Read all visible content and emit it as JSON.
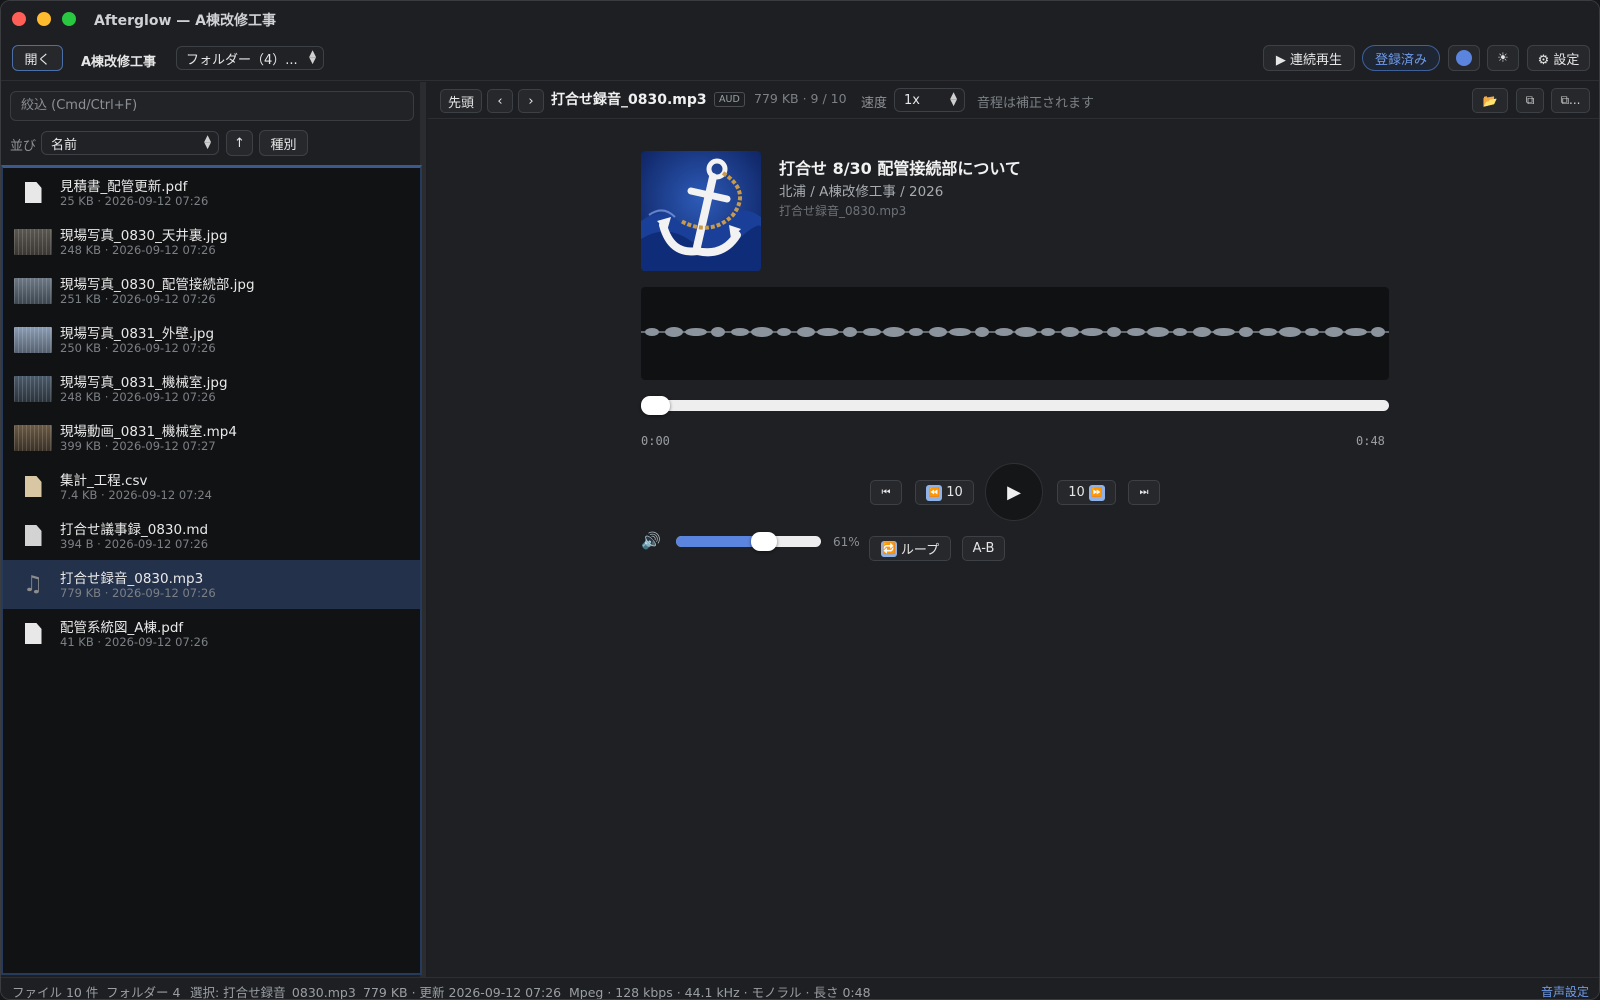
{
  "window": {
    "title": "Afterglow — A棟改修工事"
  },
  "toolbar": {
    "open_label": "開く",
    "project_label": "A棟改修工事",
    "folder_select": "フォルダー（4）...",
    "continuous_label": "▶ 連続再生",
    "registered_label": "登録済み",
    "theme_icon": "☀",
    "settings_label": "⚙ 設定",
    "accent_color": "#5b84de"
  },
  "sidebar": {
    "filter_placeholder": "絞込 (Cmd/Ctrl+F)",
    "sort_label": "並び",
    "sort_value": "名前",
    "sort_dir_icon": "↑",
    "kind_label": "種別",
    "files": [
      {
        "name": "見積書_配管更新.pdf",
        "meta": "25 KB · 2026-09-12 07:26",
        "icon": "pdf-icon"
      },
      {
        "name": "現場写真_0830_天井裏.jpg",
        "meta": "248 KB · 2026-09-12 07:26",
        "icon": "photo-thumbnail"
      },
      {
        "name": "現場写真_0830_配管接続部.jpg",
        "meta": "251 KB · 2026-09-12 07:26",
        "icon": "photo-thumbnail"
      },
      {
        "name": "現場写真_0831_外壁.jpg",
        "meta": "250 KB · 2026-09-12 07:26",
        "icon": "photo-thumbnail"
      },
      {
        "name": "現場写真_0831_機械室.jpg",
        "meta": "248 KB · 2026-09-12 07:26",
        "icon": "photo-thumbnail"
      },
      {
        "name": "現場動画_0831_機械室.mp4",
        "meta": "399 KB · 2026-09-12 07:27",
        "icon": "video-thumbnail"
      },
      {
        "name": "集計_工程.csv",
        "meta": "7.4 KB · 2026-09-12 07:24",
        "icon": "csv-icon"
      },
      {
        "name": "打合せ議事録_0830.md",
        "meta": "394 B · 2026-09-12 07:26",
        "icon": "markdown-icon"
      },
      {
        "name": "打合せ録音_0830.mp3",
        "meta": "779 KB · 2026-09-12 07:26",
        "icon": "music-note-icon",
        "selected": true
      },
      {
        "name": "配管系統図_A棟.pdf",
        "meta": "41 KB · 2026-09-12 07:26",
        "icon": "pdf-icon"
      }
    ]
  },
  "preview": {
    "first_label": "先頭",
    "prev_icon": "‹",
    "next_icon": "›",
    "filename": "打合せ録音_0830.mp3",
    "badge": "AUD",
    "meta": "779 KB · 9 / 10",
    "speed_label": "速度",
    "speed_value": "1x",
    "pitch_note": "音程は補正されます",
    "folder_icon": "📂",
    "copy_icon": "⧉",
    "copy_more_label": "⧉..."
  },
  "player": {
    "title": "打合せ 8/30 配管接続部について",
    "artist": "北浦 / A棟改修工事 / 2026",
    "file": "打合せ録音_0830.mp3",
    "time_start": "0:00",
    "time_end": "0:48",
    "progress": 0.0,
    "skip_start_icon": "⏮",
    "back_label": "10",
    "back_icon": "⏪",
    "play_icon": "▶",
    "forward_label": "10",
    "forward_icon": "⏩",
    "skip_end_icon": "⏭",
    "volume_icon": "🔊",
    "volume_percent": 61,
    "volume_label": "61%",
    "loop_icon": "🔁",
    "loop_label": "ループ",
    "ab_label": "A-B"
  },
  "status": {
    "file_count": "ファイル 10 件",
    "folder_count": "フォルダー 4",
    "selection": "選択: 打合せ録音_0830.mp3",
    "file_info": "779 KB · 更新 2026-09-12 07:26",
    "audio_info": "Mpeg · 128 kbps · 44.1 kHz · モノラル · 長さ 0:48",
    "audio_settings": "音声設定"
  }
}
